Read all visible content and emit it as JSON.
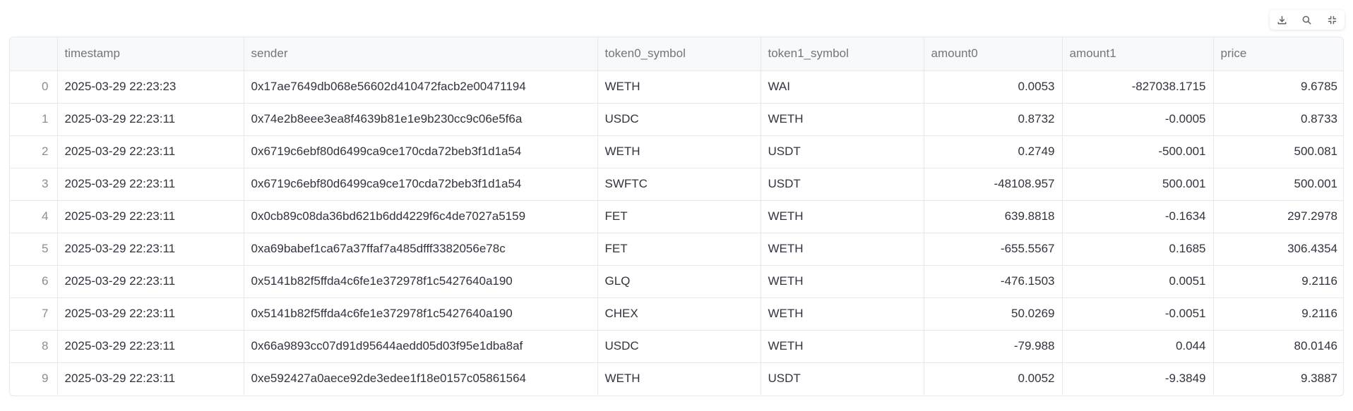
{
  "toolbar": {
    "icons": [
      "download-icon",
      "search-icon",
      "fullscreen-exit-icon"
    ]
  },
  "table": {
    "columns": [
      "",
      "timestamp",
      "sender",
      "token0_symbol",
      "token1_symbol",
      "amount0",
      "amount1",
      "price"
    ],
    "rows": [
      [
        "0",
        "2025-03-29 22:23:23",
        "0x17ae7649db068e56602d410472facb2e00471194",
        "WETH",
        "WAI",
        "0.0053",
        "-827038.1715",
        "9.6785"
      ],
      [
        "1",
        "2025-03-29 22:23:11",
        "0x74e2b8eee3ea8f4639b81e1e9b230cc9c06e5f6a",
        "USDC",
        "WETH",
        "0.8732",
        "-0.0005",
        "0.8733"
      ],
      [
        "2",
        "2025-03-29 22:23:11",
        "0x6719c6ebf80d6499ca9ce170cda72beb3f1d1a54",
        "WETH",
        "USDT",
        "0.2749",
        "-500.001",
        "500.081"
      ],
      [
        "3",
        "2025-03-29 22:23:11",
        "0x6719c6ebf80d6499ca9ce170cda72beb3f1d1a54",
        "SWFTC",
        "USDT",
        "-48108.957",
        "500.001",
        "500.001"
      ],
      [
        "4",
        "2025-03-29 22:23:11",
        "0x0cb89c08da36bd621b6dd4229f6c4de7027a5159",
        "FET",
        "WETH",
        "639.8818",
        "-0.1634",
        "297.2978"
      ],
      [
        "5",
        "2025-03-29 22:23:11",
        "0xa69babef1ca67a37ffaf7a485dfff3382056e78c",
        "FET",
        "WETH",
        "-655.5567",
        "0.1685",
        "306.4354"
      ],
      [
        "6",
        "2025-03-29 22:23:11",
        "0x5141b82f5ffda4c6fe1e372978f1c5427640a190",
        "GLQ",
        "WETH",
        "-476.1503",
        "0.0051",
        "9.2116"
      ],
      [
        "7",
        "2025-03-29 22:23:11",
        "0x5141b82f5ffda4c6fe1e372978f1c5427640a190",
        "CHEX",
        "WETH",
        "50.0269",
        "-0.0051",
        "9.2116"
      ],
      [
        "8",
        "2025-03-29 22:23:11",
        "0x66a9893cc07d91d95644aedd05d03f95e1dba8af",
        "USDC",
        "WETH",
        "-79.988",
        "0.044",
        "80.0146"
      ],
      [
        "9",
        "2025-03-29 22:23:11",
        "0xe592427a0aece92de3edee1f18e0157c05861564",
        "WETH",
        "USDT",
        "0.0052",
        "-9.3849",
        "9.3887"
      ]
    ]
  }
}
